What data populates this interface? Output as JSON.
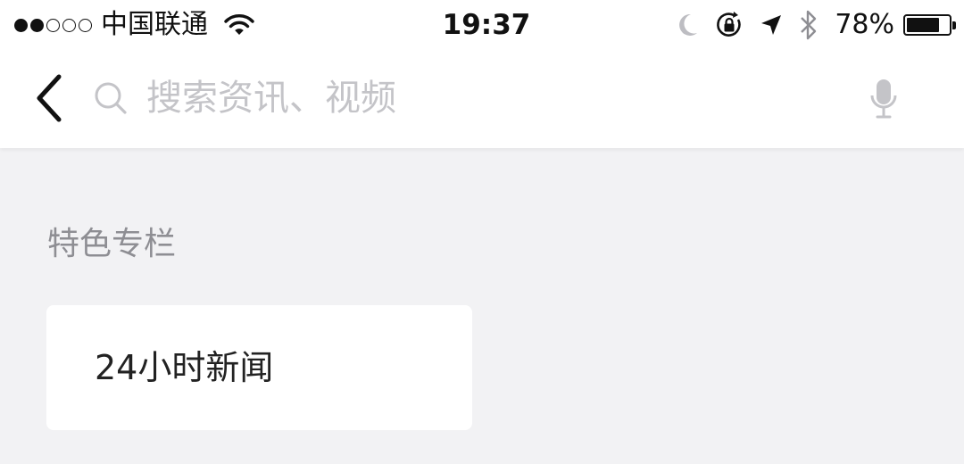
{
  "status_bar": {
    "signal_bars_filled": 2,
    "signal_bars_total": 5,
    "carrier": "中国联通",
    "time": "19:37",
    "battery_percent_text": "78%",
    "battery_level": 0.78,
    "icons": [
      "wifi-icon",
      "moon-icon",
      "rotation-lock-icon",
      "location-arrow-icon",
      "bluetooth-icon",
      "battery-icon"
    ]
  },
  "search": {
    "placeholder": "搜索资讯、视频",
    "value": "",
    "icons": [
      "back-chevron-icon",
      "search-icon",
      "microphone-icon"
    ]
  },
  "section": {
    "title": "特色专栏",
    "items": [
      {
        "label": "24小时新闻"
      }
    ]
  },
  "colors": {
    "background": "#f2f2f4",
    "header_background": "#ffffff",
    "placeholder": "#c4c4c8",
    "section_title": "#8e8e93",
    "text": "#222222"
  }
}
